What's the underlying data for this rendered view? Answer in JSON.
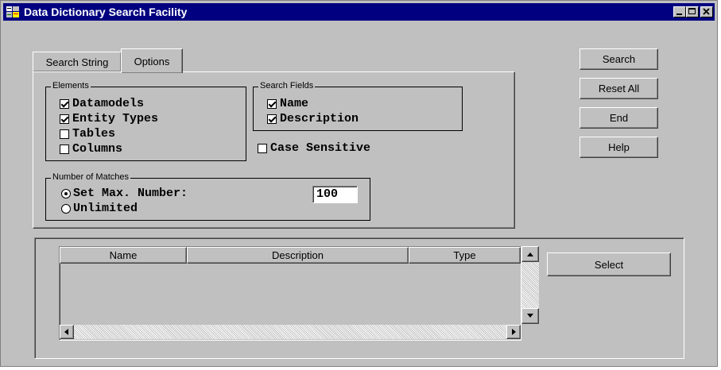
{
  "window": {
    "title": "Data Dictionary Search Facility"
  },
  "tabs": [
    {
      "label": "Search String"
    },
    {
      "label": "Options"
    }
  ],
  "elements_group": {
    "label": "Elements",
    "items": [
      {
        "label": "Datamodels",
        "checked": true
      },
      {
        "label": "Entity Types",
        "checked": true
      },
      {
        "label": "Tables",
        "checked": false
      },
      {
        "label": "Columns",
        "checked": false
      }
    ]
  },
  "search_fields_group": {
    "label": "Search Fields",
    "items": [
      {
        "label": "Name",
        "checked": true
      },
      {
        "label": "Description",
        "checked": true
      }
    ]
  },
  "case_sensitive": {
    "label": "Case Sensitive",
    "checked": false
  },
  "matches_group": {
    "label": "Number of Matches",
    "set_max_label": "Set Max. Number:",
    "unlimited_label": "Unlimited",
    "selected": "set_max",
    "max_value": "100"
  },
  "buttons": {
    "search": "Search",
    "reset_all": "Reset All",
    "end": "End",
    "help": "Help",
    "select": "Select"
  },
  "results_table": {
    "columns": [
      "Name",
      "Description",
      "Type"
    ],
    "rows": []
  },
  "colors": {
    "title_bar": "#000080",
    "face": "#c0c0c0"
  }
}
